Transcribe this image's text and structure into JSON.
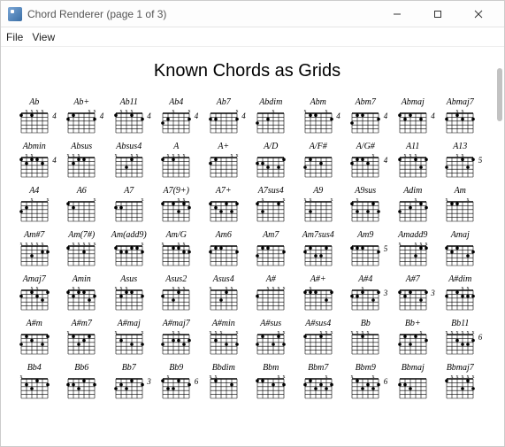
{
  "window": {
    "title": "Chord Renderer (page 1 of 3)"
  },
  "menubar": {
    "file": "File",
    "view": "View"
  },
  "page": {
    "title": "Known Chords as Grids"
  },
  "chords": {
    "rows": [
      [
        {
          "label": "Ab",
          "pos": "4"
        },
        {
          "label": "Ab+",
          "pos": "4"
        },
        {
          "label": "Ab11",
          "pos": "4"
        },
        {
          "label": "Ab4",
          "pos": "4"
        },
        {
          "label": "Ab7",
          "pos": "4"
        },
        {
          "label": "Abdim",
          "pos": ""
        },
        {
          "label": "Abm",
          "pos": "4"
        },
        {
          "label": "Abm7",
          "pos": "4"
        },
        {
          "label": "Abmaj",
          "pos": "4"
        },
        {
          "label": "Abmaj7",
          "pos": ""
        }
      ],
      [
        {
          "label": "Abmin",
          "pos": "4"
        },
        {
          "label": "Absus",
          "pos": ""
        },
        {
          "label": "Absus4",
          "pos": ""
        },
        {
          "label": "A",
          "pos": ""
        },
        {
          "label": "A+",
          "pos": ""
        },
        {
          "label": "A/D",
          "pos": ""
        },
        {
          "label": "A/F#",
          "pos": ""
        },
        {
          "label": "A/G#",
          "pos": "4"
        },
        {
          "label": "A11",
          "pos": ""
        },
        {
          "label": "A13",
          "pos": "5"
        }
      ],
      [
        {
          "label": "A4",
          "pos": ""
        },
        {
          "label": "A6",
          "pos": ""
        },
        {
          "label": "A7",
          "pos": ""
        },
        {
          "label": "A7(9+)",
          "pos": ""
        },
        {
          "label": "A7+",
          "pos": ""
        },
        {
          "label": "A7sus4",
          "pos": ""
        },
        {
          "label": "A9",
          "pos": ""
        },
        {
          "label": "A9sus",
          "pos": ""
        },
        {
          "label": "Adim",
          "pos": ""
        },
        {
          "label": "Am",
          "pos": ""
        }
      ],
      [
        {
          "label": "Am#7",
          "pos": ""
        },
        {
          "label": "Am(7#)",
          "pos": ""
        },
        {
          "label": "Am(add9)",
          "pos": ""
        },
        {
          "label": "Am/G",
          "pos": ""
        },
        {
          "label": "Am6",
          "pos": ""
        },
        {
          "label": "Am7",
          "pos": ""
        },
        {
          "label": "Am7sus4",
          "pos": ""
        },
        {
          "label": "Am9",
          "pos": "5"
        },
        {
          "label": "Amadd9",
          "pos": ""
        },
        {
          "label": "Amaj",
          "pos": ""
        }
      ],
      [
        {
          "label": "Amaj7",
          "pos": ""
        },
        {
          "label": "Amin",
          "pos": ""
        },
        {
          "label": "Asus",
          "pos": ""
        },
        {
          "label": "Asus2",
          "pos": ""
        },
        {
          "label": "Asus4",
          "pos": ""
        },
        {
          "label": "A#",
          "pos": ""
        },
        {
          "label": "A#+",
          "pos": ""
        },
        {
          "label": "A#4",
          "pos": "3"
        },
        {
          "label": "A#7",
          "pos": "3"
        },
        {
          "label": "A#dim",
          "pos": ""
        }
      ],
      [
        {
          "label": "A#m",
          "pos": ""
        },
        {
          "label": "A#m7",
          "pos": ""
        },
        {
          "label": "A#maj",
          "pos": ""
        },
        {
          "label": "A#maj7",
          "pos": ""
        },
        {
          "label": "A#min",
          "pos": ""
        },
        {
          "label": "A#sus",
          "pos": ""
        },
        {
          "label": "A#sus4",
          "pos": ""
        },
        {
          "label": "Bb",
          "pos": ""
        },
        {
          "label": "Bb+",
          "pos": ""
        },
        {
          "label": "Bb11",
          "pos": "6"
        }
      ],
      [
        {
          "label": "Bb4",
          "pos": ""
        },
        {
          "label": "Bb6",
          "pos": ""
        },
        {
          "label": "Bb7",
          "pos": "3"
        },
        {
          "label": "Bb9",
          "pos": "6"
        },
        {
          "label": "Bbdim",
          "pos": ""
        },
        {
          "label": "Bbm",
          "pos": ""
        },
        {
          "label": "Bbm7",
          "pos": ""
        },
        {
          "label": "Bbm9",
          "pos": "6"
        },
        {
          "label": "Bbmaj",
          "pos": ""
        },
        {
          "label": "Bbmaj7",
          "pos": ""
        }
      ]
    ]
  }
}
